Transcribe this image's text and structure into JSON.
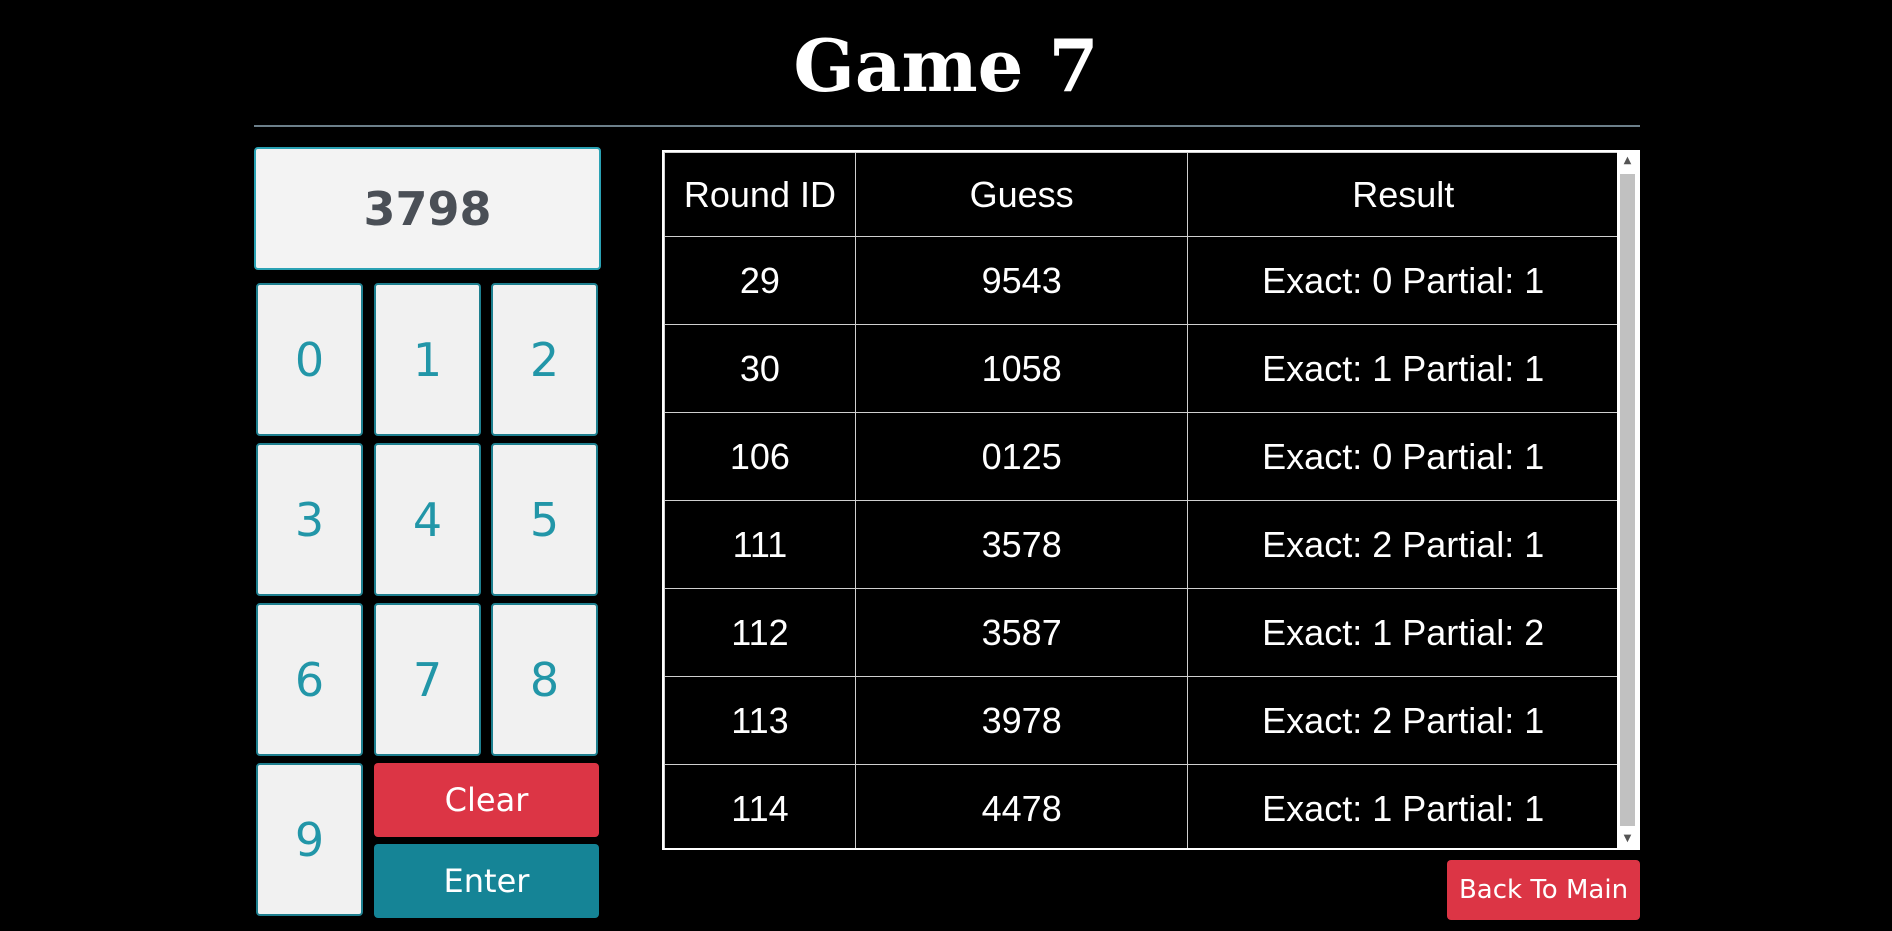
{
  "title": "Game 7",
  "display": {
    "value": "3798"
  },
  "keypad": {
    "keys": [
      "0",
      "1",
      "2",
      "3",
      "4",
      "5",
      "6",
      "7",
      "8",
      "9"
    ]
  },
  "buttons": {
    "clear": "Clear",
    "enter": "Enter",
    "back": "Back To Main"
  },
  "table": {
    "headers": [
      "Round ID",
      "Guess",
      "Result"
    ],
    "rows": [
      {
        "round": "29",
        "guess": "9543",
        "result": "Exact: 0 Partial: 1"
      },
      {
        "round": "30",
        "guess": "1058",
        "result": "Exact: 1 Partial: 1"
      },
      {
        "round": "106",
        "guess": "0125",
        "result": "Exact: 0 Partial: 1"
      },
      {
        "round": "111",
        "guess": "3578",
        "result": "Exact: 2 Partial: 1"
      },
      {
        "round": "112",
        "guess": "3587",
        "result": "Exact: 1 Partial: 2"
      },
      {
        "round": "113",
        "guess": "3978",
        "result": "Exact: 2 Partial: 1"
      },
      {
        "round": "114",
        "guess": "4478",
        "result": "Exact: 1 Partial: 1"
      }
    ]
  },
  "colors": {
    "background": "#000000",
    "accent": "#158496",
    "danger": "#dc3545",
    "key_text": "#2296a8"
  }
}
